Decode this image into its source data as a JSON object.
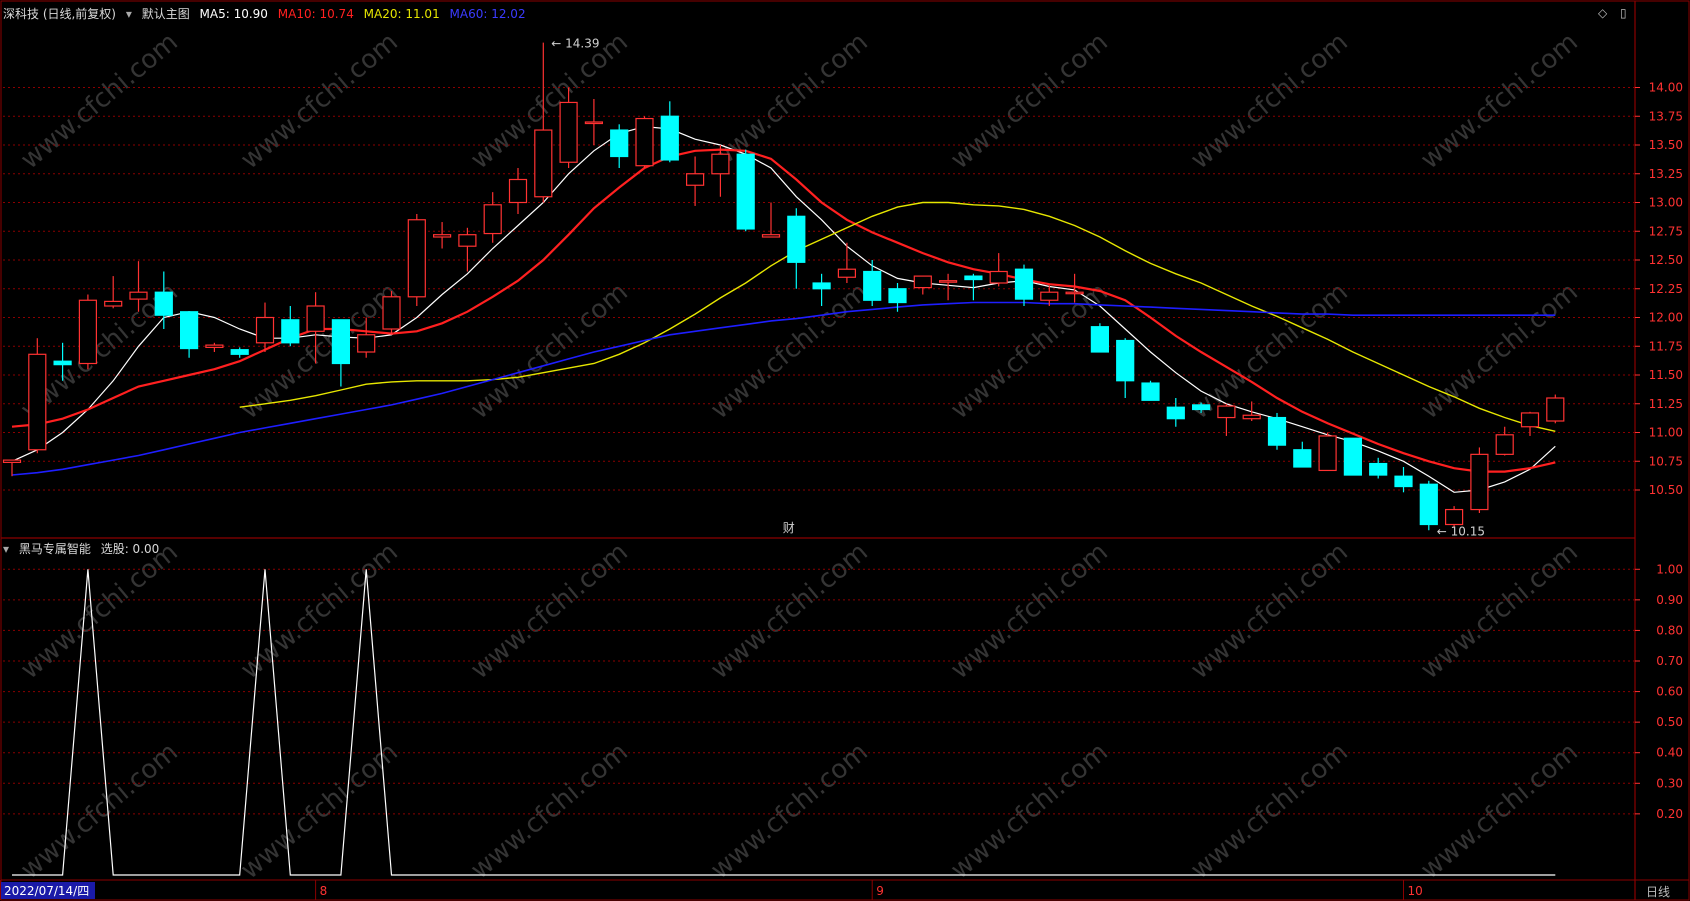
{
  "header": {
    "title": "深科技 (日线,前复权)",
    "main_label": "默认主图",
    "ma5": "MA5: 10.90",
    "ma10": "MA10: 10.74",
    "ma20": "MA20: 11.01",
    "ma60": "MA60: 12.02"
  },
  "indicator": {
    "title": "黑马专属智能",
    "value": "选股: 0.00"
  },
  "corner": {
    "period": "日线"
  },
  "annotations": {
    "fin_marker": "财"
  },
  "watermark": "www.cfchi.com",
  "colors": {
    "up": "#ff3232",
    "down": "#00ffff",
    "ma5": "#ffffff",
    "ma10": "#ff2020",
    "ma20": "#e6e600",
    "ma60": "#1e1eff",
    "grid": "#8b0000",
    "axis_text": "#ff3232",
    "indicator_line": "#ffffff"
  },
  "chart_data": [
    {
      "type": "candlestick",
      "title": "",
      "ylim": [
        10.1,
        14.5
      ],
      "y_ticks": [
        10.5,
        10.75,
        11.0,
        11.25,
        11.5,
        11.75,
        12.0,
        12.25,
        12.5,
        12.75,
        13.0,
        13.25,
        13.5,
        13.75,
        14.0
      ],
      "y_tick_labels": [
        "10.50",
        "10.75",
        "11.00",
        "11.25",
        "11.50",
        "11.75",
        "12.00",
        "12.25",
        "12.50",
        "12.75",
        "13.00",
        "13.25",
        "13.50",
        "13.75",
        "14.00"
      ],
      "x_labels": [
        {
          "index": 0,
          "label": "2022/07/14/四"
        },
        {
          "index": 12,
          "label": "8"
        },
        {
          "index": 34,
          "label": "9"
        },
        {
          "index": 55,
          "label": "10"
        }
      ],
      "high_label": "14.39",
      "low_label": "10.15",
      "candles": [
        {
          "o": 10.74,
          "h": 10.76,
          "l": 10.62,
          "c": 10.76
        },
        {
          "o": 10.85,
          "h": 11.82,
          "l": 10.82,
          "c": 11.68
        },
        {
          "o": 11.62,
          "h": 11.78,
          "l": 11.45,
          "c": 11.59
        },
        {
          "o": 11.6,
          "h": 12.2,
          "l": 11.55,
          "c": 12.15
        },
        {
          "o": 12.1,
          "h": 12.36,
          "l": 12.08,
          "c": 12.14
        },
        {
          "o": 12.16,
          "h": 12.49,
          "l": 12.05,
          "c": 12.22
        },
        {
          "o": 12.22,
          "h": 12.4,
          "l": 11.9,
          "c": 12.02
        },
        {
          "o": 12.05,
          "h": 12.05,
          "l": 11.65,
          "c": 11.73
        },
        {
          "o": 11.74,
          "h": 11.78,
          "l": 11.7,
          "c": 11.76
        },
        {
          "o": 11.72,
          "h": 11.74,
          "l": 11.65,
          "c": 11.68
        },
        {
          "o": 11.78,
          "h": 12.13,
          "l": 11.7,
          "c": 12.0
        },
        {
          "o": 11.98,
          "h": 12.1,
          "l": 11.75,
          "c": 11.78
        },
        {
          "o": 11.88,
          "h": 12.22,
          "l": 11.6,
          "c": 12.1
        },
        {
          "o": 11.98,
          "h": 11.98,
          "l": 11.4,
          "c": 11.6
        },
        {
          "o": 11.7,
          "h": 12.0,
          "l": 11.65,
          "c": 11.85
        },
        {
          "o": 11.9,
          "h": 12.23,
          "l": 11.85,
          "c": 12.18
        },
        {
          "o": 12.18,
          "h": 12.9,
          "l": 12.1,
          "c": 12.85
        },
        {
          "o": 12.7,
          "h": 12.83,
          "l": 12.6,
          "c": 12.72
        },
        {
          "o": 12.62,
          "h": 12.78,
          "l": 12.4,
          "c": 12.72
        },
        {
          "o": 12.73,
          "h": 13.09,
          "l": 12.65,
          "c": 12.98
        },
        {
          "o": 13.0,
          "h": 13.3,
          "l": 12.9,
          "c": 13.2
        },
        {
          "o": 13.05,
          "h": 14.39,
          "l": 13.0,
          "c": 13.63
        },
        {
          "o": 13.35,
          "h": 14.0,
          "l": 13.3,
          "c": 13.87
        },
        {
          "o": 13.7,
          "h": 13.9,
          "l": 13.5,
          "c": 13.7
        },
        {
          "o": 13.63,
          "h": 13.68,
          "l": 13.3,
          "c": 13.4
        },
        {
          "o": 13.32,
          "h": 13.75,
          "l": 13.3,
          "c": 13.73
        },
        {
          "o": 13.75,
          "h": 13.88,
          "l": 13.35,
          "c": 13.37
        },
        {
          "o": 13.15,
          "h": 13.4,
          "l": 12.97,
          "c": 13.25
        },
        {
          "o": 13.25,
          "h": 13.5,
          "l": 13.05,
          "c": 13.42
        },
        {
          "o": 13.42,
          "h": 13.46,
          "l": 12.75,
          "c": 12.77
        },
        {
          "o": 12.7,
          "h": 13.0,
          "l": 12.7,
          "c": 12.72
        },
        {
          "o": 12.88,
          "h": 12.95,
          "l": 12.25,
          "c": 12.48
        },
        {
          "o": 12.3,
          "h": 12.38,
          "l": 12.1,
          "c": 12.25
        },
        {
          "o": 12.35,
          "h": 12.65,
          "l": 12.3,
          "c": 12.42
        },
        {
          "o": 12.4,
          "h": 12.5,
          "l": 12.1,
          "c": 12.15
        },
        {
          "o": 12.25,
          "h": 12.3,
          "l": 12.05,
          "c": 12.13
        },
        {
          "o": 12.26,
          "h": 12.36,
          "l": 12.2,
          "c": 12.36
        },
        {
          "o": 12.32,
          "h": 12.38,
          "l": 12.15,
          "c": 12.32
        },
        {
          "o": 12.36,
          "h": 12.38,
          "l": 12.15,
          "c": 12.33
        },
        {
          "o": 12.3,
          "h": 12.56,
          "l": 12.27,
          "c": 12.4
        },
        {
          "o": 12.42,
          "h": 12.46,
          "l": 12.1,
          "c": 12.16
        },
        {
          "o": 12.15,
          "h": 12.28,
          "l": 12.1,
          "c": 12.22
        },
        {
          "o": 12.22,
          "h": 12.38,
          "l": 12.13,
          "c": 12.22
        },
        {
          "o": 11.92,
          "h": 11.95,
          "l": 11.7,
          "c": 11.7
        },
        {
          "o": 11.8,
          "h": 11.82,
          "l": 11.3,
          "c": 11.45
        },
        {
          "o": 11.43,
          "h": 11.45,
          "l": 11.28,
          "c": 11.28
        },
        {
          "o": 11.22,
          "h": 11.3,
          "l": 11.05,
          "c": 11.12
        },
        {
          "o": 11.24,
          "h": 11.26,
          "l": 11.17,
          "c": 11.2
        },
        {
          "o": 11.13,
          "h": 11.25,
          "l": 10.97,
          "c": 11.23
        },
        {
          "o": 11.12,
          "h": 11.27,
          "l": 11.1,
          "c": 11.15
        },
        {
          "o": 11.13,
          "h": 11.17,
          "l": 10.85,
          "c": 10.89
        },
        {
          "o": 10.85,
          "h": 10.92,
          "l": 10.7,
          "c": 10.7
        },
        {
          "o": 10.67,
          "h": 11.0,
          "l": 10.67,
          "c": 10.97
        },
        {
          "o": 10.95,
          "h": 10.95,
          "l": 10.63,
          "c": 10.63
        },
        {
          "o": 10.73,
          "h": 10.78,
          "l": 10.6,
          "c": 10.63
        },
        {
          "o": 10.62,
          "h": 10.7,
          "l": 10.48,
          "c": 10.53
        },
        {
          "o": 10.55,
          "h": 10.58,
          "l": 10.15,
          "c": 10.2
        },
        {
          "o": 10.2,
          "h": 10.36,
          "l": 10.18,
          "c": 10.33
        },
        {
          "o": 10.33,
          "h": 10.87,
          "l": 10.3,
          "c": 10.81
        },
        {
          "o": 10.81,
          "h": 11.05,
          "l": 10.8,
          "c": 10.98
        },
        {
          "o": 11.05,
          "h": 11.18,
          "l": 10.97,
          "c": 11.17
        },
        {
          "o": 11.1,
          "h": 11.33,
          "l": 11.08,
          "c": 11.3
        }
      ],
      "series": [
        {
          "name": "MA5",
          "values": [
            10.75,
            10.85,
            11.0,
            11.2,
            11.45,
            11.75,
            12.0,
            12.05,
            12.0,
            11.9,
            11.82,
            11.82,
            11.85,
            11.83,
            11.82,
            11.85,
            12.0,
            12.2,
            12.38,
            12.6,
            12.8,
            13.0,
            13.25,
            13.45,
            13.6,
            13.66,
            13.64,
            13.55,
            13.5,
            13.42,
            13.3,
            13.05,
            12.85,
            12.62,
            12.45,
            12.34,
            12.3,
            12.28,
            12.26,
            12.3,
            12.32,
            12.27,
            12.24,
            12.1,
            11.9,
            11.7,
            11.52,
            11.36,
            11.25,
            11.18,
            11.12,
            11.05,
            10.98,
            10.92,
            10.84,
            10.75,
            10.62,
            10.48,
            10.5,
            10.57,
            10.68,
            10.88
          ]
        },
        {
          "name": "MA10",
          "values": [
            11.05,
            11.07,
            11.12,
            11.2,
            11.3,
            11.4,
            11.45,
            11.5,
            11.55,
            11.62,
            11.72,
            11.82,
            11.9,
            11.9,
            11.88,
            11.86,
            11.88,
            11.95,
            12.05,
            12.18,
            12.32,
            12.5,
            12.72,
            12.95,
            13.13,
            13.3,
            13.4,
            13.45,
            13.46,
            13.45,
            13.38,
            13.2,
            13.0,
            12.85,
            12.74,
            12.65,
            12.56,
            12.48,
            12.42,
            12.38,
            12.33,
            12.29,
            12.27,
            12.23,
            12.15,
            12.0,
            11.84,
            11.7,
            11.57,
            11.44,
            11.3,
            11.18,
            11.08,
            10.99,
            10.9,
            10.82,
            10.75,
            10.69,
            10.66,
            10.66,
            10.69,
            10.74
          ]
        },
        {
          "name": "MA20",
          "values": [
            11.22,
            11.25,
            11.28,
            11.32,
            11.37,
            11.42,
            11.44,
            11.45,
            11.45,
            11.45,
            11.46,
            11.48,
            11.52,
            11.56,
            11.6,
            11.68,
            11.78,
            11.9,
            12.03,
            12.17,
            12.3,
            12.45,
            12.58,
            12.68,
            12.78,
            12.88,
            12.96,
            13.0,
            13.0,
            12.98,
            12.97,
            12.94,
            12.88,
            12.8,
            12.7,
            12.58,
            12.47,
            12.38,
            12.3,
            12.2,
            12.1,
            12.01,
            11.91,
            11.81,
            11.7,
            11.6,
            11.5,
            11.4,
            11.31,
            11.21,
            11.13,
            11.06,
            11.01
          ]
        },
        {
          "name": "MA60",
          "values": [
            10.63,
            10.65,
            10.68,
            10.72,
            10.76,
            10.8,
            10.85,
            10.9,
            10.95,
            11.0,
            11.04,
            11.08,
            11.12,
            11.16,
            11.2,
            11.24,
            11.29,
            11.34,
            11.4,
            11.46,
            11.52,
            11.58,
            11.64,
            11.7,
            11.75,
            11.8,
            11.85,
            11.88,
            11.91,
            11.94,
            11.97,
            11.99,
            12.02,
            12.05,
            12.07,
            12.09,
            12.11,
            12.12,
            12.13,
            12.13,
            12.13,
            12.12,
            12.12,
            12.11,
            12.1,
            12.09,
            12.08,
            12.07,
            12.06,
            12.05,
            12.04,
            12.03,
            12.03,
            12.02,
            12.02,
            12.02,
            12.02,
            12.02,
            12.02,
            12.02,
            12.02,
            12.02
          ]
        }
      ]
    },
    {
      "type": "line",
      "title": "",
      "ylim": [
        0,
        1.05
      ],
      "y_ticks": [
        0.2,
        0.3,
        0.4,
        0.5,
        0.6,
        0.7,
        0.8,
        0.9,
        1.0
      ],
      "y_tick_labels": [
        "0.20",
        "0.30",
        "0.40",
        "0.50",
        "0.60",
        "0.70",
        "0.80",
        "0.90",
        "1.00"
      ],
      "series": [
        {
          "values": [
            0,
            0,
            0,
            1,
            0,
            0,
            0,
            0,
            0,
            0,
            1,
            0,
            0,
            0,
            1,
            0,
            0,
            0,
            0,
            0,
            0,
            0,
            0,
            0,
            0,
            0,
            0,
            0,
            0,
            0,
            0,
            0,
            0,
            0,
            0,
            0,
            0,
            0,
            0,
            0,
            0,
            0,
            0,
            0,
            0,
            0,
            0,
            0,
            0,
            0,
            0,
            0,
            0,
            0,
            0,
            0,
            0,
            0,
            0,
            0,
            0,
            0
          ]
        }
      ]
    }
  ]
}
